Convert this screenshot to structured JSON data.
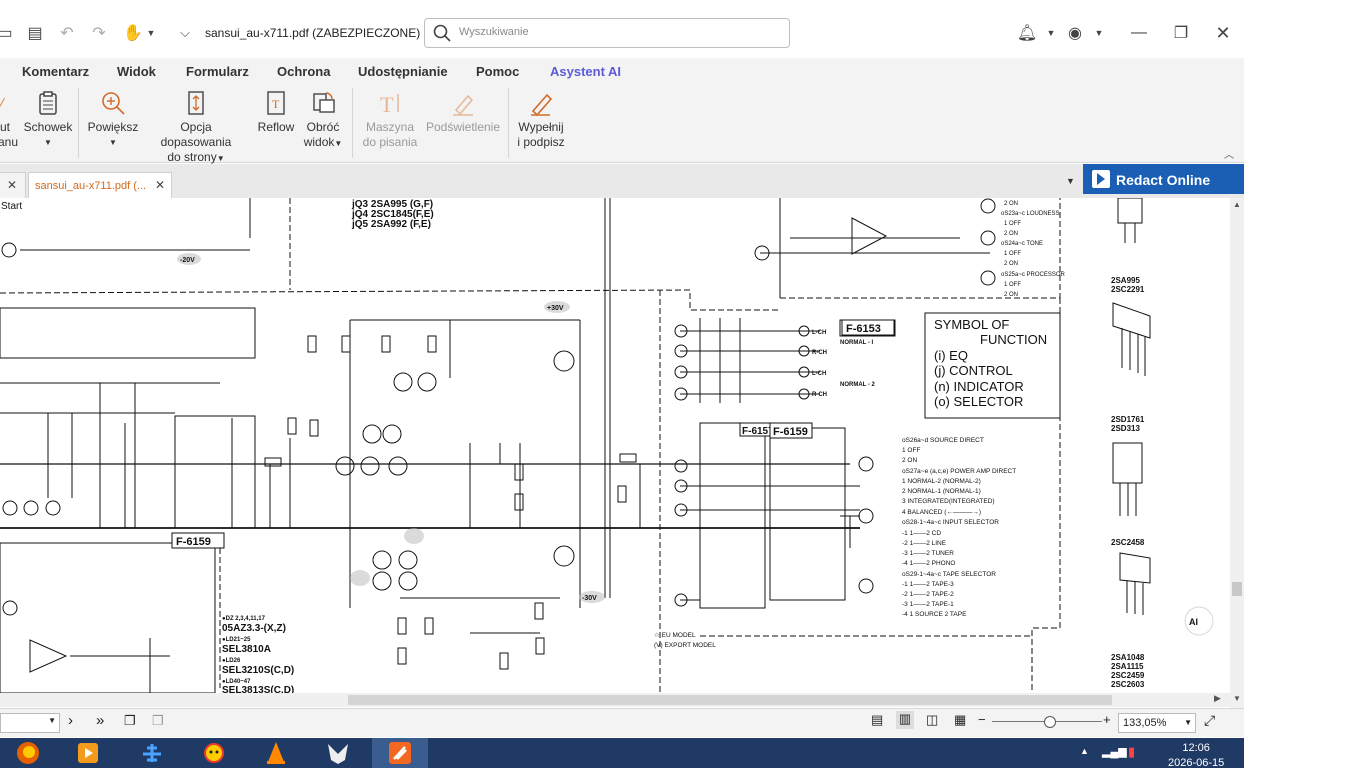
{
  "window": {
    "title": "sansui_au-x711.pdf (ZABEZPIECZONE) - F...",
    "search_placeholder": "Wyszukiwanie"
  },
  "menu": {
    "items": [
      "Komentarz",
      "Widok",
      "Formularz",
      "Ochrona",
      "Udostępnianie",
      "Pomoc",
      "Asystent AI"
    ]
  },
  "ribbon": {
    "partial_left": [
      "ut",
      "anu"
    ],
    "schowek": "Schowek",
    "powieksz": "Powiększ",
    "opcja_1": "Opcja dopasowania",
    "opcja_2": "do strony",
    "reflow": "Reflow",
    "obroc_1": "Obróć",
    "obroc_2": "widok",
    "maszyna_1": "Maszyna",
    "maszyna_2": "do pisania",
    "podswietlenie": "Podświetlenie",
    "wypelnij_1": "Wypełnij",
    "wypelnij_2": "i podpisz"
  },
  "tabs": {
    "active": "sansui_au-x711.pdf (...",
    "redact": "Redact Online",
    "start": "Start"
  },
  "schematic": {
    "boards": [
      "F-6153",
      "F-6157",
      "F-6159",
      "F-6159"
    ],
    "transistor_list": [
      "jQ3   2SA995 (G,F)",
      "jQ4   2SC1845(F,E)",
      "jQ5   2SA992 (F,E)"
    ],
    "voltages": [
      "-20V",
      "+30V",
      "-30V"
    ],
    "symbol_title_1": "SYMBOL OF",
    "symbol_title_2": "FUNCTION",
    "symbols": [
      "(i) EQ",
      "(j) CONTROL",
      "(n) INDICATOR",
      "(o) SELECTOR"
    ],
    "normal": [
      "NORMAL - I",
      "NORMAL - 2"
    ],
    "lch": "L-CH",
    "rch": "R-CH",
    "switch_notes": [
      "oS26a~d SOURCE DIRECT",
      "  1  OFF",
      "  2  ON",
      "oS27a~e (a,c,e) POWER AMP DIRECT",
      "  1  NORMAL-2 (NORMAL-2)",
      "  2  NORMAL-1 (NORMAL-1)",
      "  3  INTEGRATED(INTEGRATED)",
      "  4  BALANCED (←———→)",
      "oS28-1~4a~c INPUT SELECTOR",
      "  -1  1——2  CD",
      "  -2  1——2  LINE",
      "  -3  1——2  TUNER",
      "  -4  1——2  PHONO",
      "oS29-1~4a~c TAPE SELECTOR",
      "  -1  1——2  TAPE-3",
      "  -2  1——2  TAPE-2",
      "  -3  1——2  TAPE-1",
      "  -4  1  SOURCE 2  TAPE"
    ],
    "top_right_notes": [
      "2 ON",
      "oS23a~c LOUDNESS",
      "1 OFF",
      "2 ON",
      "oS24a~c TONE",
      "1 OFF",
      "2 ON",
      "oS25a~c PROCESSOR",
      "1 OFF",
      "2 ON"
    ],
    "model_notes": [
      "☆ EU MODEL",
      "(V) EXPORT MODEL"
    ],
    "diode_notes": [
      "●DZ 2,3,4,11,17",
      "05AZ3.3-(X,Z)",
      "●LD21~25",
      "SEL3810A",
      "●LD26",
      "SEL3210S(C,D)",
      "●LD40~47",
      "SEL3813S(C,D)"
    ],
    "part_right": [
      "2SA995",
      "2SC2291",
      "2SD1761",
      "2SD313",
      "2SC2458",
      "2SA1048",
      "2SA1115",
      "2SC2459",
      "2SC2603"
    ]
  },
  "statusbar": {
    "zoom": "133,05%"
  },
  "taskbar": {
    "time": "12:06",
    "date": "2026-06-15"
  },
  "colors": {
    "accent_blue": "#1a5fb4",
    "ai_purple": "#5b5bd6",
    "tab_orange": "#d2691e",
    "taskbar": "#1f3a64"
  }
}
